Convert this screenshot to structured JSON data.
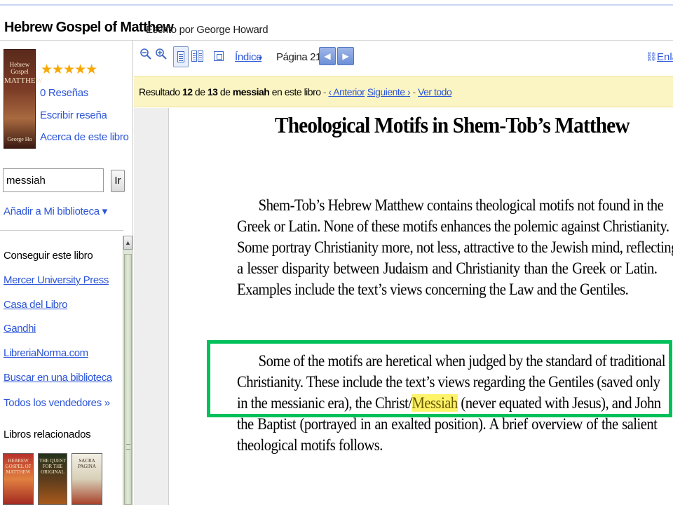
{
  "header": {
    "title": "Hebrew Gospel of Matthew",
    "author": "Escrito por George Howard"
  },
  "cover": {
    "line1": "Hebrew Gospel",
    "line2": "MATTHEW",
    "line3": "",
    "line4": "George Ho"
  },
  "sidebar": {
    "rating": "★★★★★",
    "reviews_link": "0 Reseñas",
    "write_review_link": "Escribir reseña",
    "about_link": "Acerca de este libro",
    "search_value": "messiah",
    "go_button": "Ir",
    "add_library": "Añadir a Mi biblioteca ▾",
    "get_book_heading": "Conseguir este libro",
    "vendors": [
      "Mercer University Press",
      "Casa del Libro",
      "Gandhi",
      "LibreriaNorma.com",
      "Buscar en una biblioteca"
    ],
    "all_vendors": "Todos los vendedores »",
    "related_heading": "Libros relacionados",
    "related_thumbs": [
      "HEBREW GOSPEL OF MATTHEW",
      "THE QUEST FOR THE ORIGINAL",
      "SACRA PAGINA"
    ]
  },
  "toolbar": {
    "zoom_out": "zoom-out",
    "zoom_in": "zoom-in",
    "index_label": "Índice",
    "page_label": "Página 212",
    "prev": "◀",
    "next": "▶",
    "link_label": "Enla"
  },
  "results": {
    "prefix": "Resultado",
    "current": "12",
    "of": "de",
    "total": "13",
    "de": "de",
    "term": "messiah",
    "scope": "en este libro",
    "prev_link": "‹ Anterior",
    "next_link": "Siguiente ›",
    "all_link": "Ver todo"
  },
  "page": {
    "title": "Theological Motifs in Shem-Tob’s Matthew",
    "para1": [
      "Shem-Tob’s Hebrew Matthew contains theological motifs not found in the",
      "Greek or Latin. None of these motifs enhances the polemic against Christianity.",
      "Some portray Christianity more, not less, attractive to the Jewish mind, reflecting",
      "a lesser disparity between Judaism and Christianity than the Greek or Latin.",
      "Examples include the text’s views concerning the Law and the Gentiles."
    ],
    "para2_l1": "Some of the motifs are heretical when judged by the standard of traditional",
    "para2_l2": "Christianity. These include the text’s views regarding the Gentiles (saved only",
    "para2_l3a": "in the messianic era), the Christ/",
    "para2_l3_hl": "Messiah",
    "para2_l3b": " (never equated with Jesus), and John",
    "para2_l4": "the Baptist (portrayed in an exalted position). A brief overview of the salient",
    "para2_l5": "theological motifs follows."
  },
  "colors": {
    "link": "#2c55d7",
    "highlight_box": "#00c05a",
    "results_bg": "#fbf5c4",
    "term_highlight": "#fff36a"
  }
}
